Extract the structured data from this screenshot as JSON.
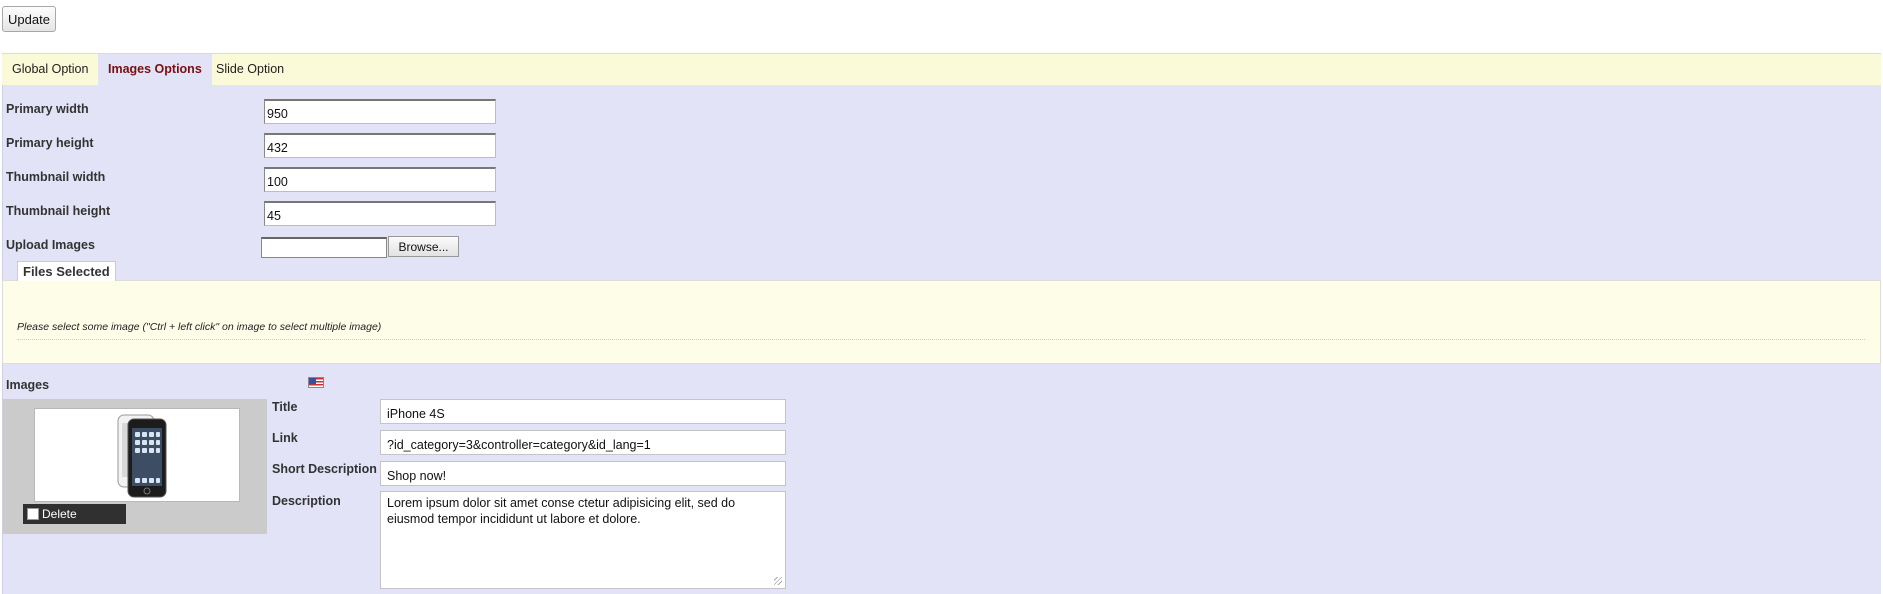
{
  "toolbar": {
    "update_label": "Update"
  },
  "tabs": [
    {
      "label": "Global Option",
      "active": false
    },
    {
      "label": "Images Options",
      "active": true
    },
    {
      "label": "Slide Option",
      "active": false
    }
  ],
  "form": {
    "primary_width": {
      "label": "Primary width",
      "value": "950"
    },
    "primary_height": {
      "label": "Primary height",
      "value": "432"
    },
    "thumbnail_width": {
      "label": "Thumbnail width",
      "value": "100"
    },
    "thumbnail_height": {
      "label": "Thumbnail height",
      "value": "45"
    },
    "upload": {
      "label": "Upload Images",
      "browse_label": "Browse..."
    }
  },
  "files_selected": {
    "legend": "Files Selected",
    "note": "Please select some image (\"Ctrl + left click\" on image to select multiple image)"
  },
  "images": {
    "heading": "Images",
    "language_flag": "us-flag-icon",
    "delete_label": "Delete",
    "title": {
      "label": "Title",
      "value": "iPhone 4S"
    },
    "link": {
      "label": "Link",
      "value": "?id_category=3&controller=category&id_lang=1"
    },
    "short_description": {
      "label": "Short Description",
      "value": "Shop now!"
    },
    "description": {
      "label": "Description",
      "value": "Lorem ipsum dolor sit amet conse ctetur adipisicing elit, sed do eiusmod tempor incididunt ut labore et dolore."
    }
  },
  "colors": {
    "tabbar_bg": "#fafad8",
    "panel_bg": "#e3e3f7",
    "active_tab_text": "#7a1010"
  }
}
